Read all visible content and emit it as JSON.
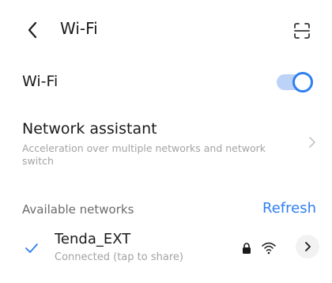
{
  "header": {
    "title": "Wi-Fi",
    "back_icon": "back-arrow-icon",
    "scan_icon": "scan-icon"
  },
  "wifi_toggle": {
    "label": "Wi-Fi",
    "enabled": true,
    "accent_color": "#2f7ff0"
  },
  "network_assistant": {
    "title": "Network assistant",
    "description": "Acceleration over multiple networks and network switch"
  },
  "available": {
    "label": "Available networks",
    "refresh_label": "Refresh"
  },
  "networks": [
    {
      "name": "Tenda_EXT",
      "status": "Connected (tap to share)",
      "connected": true,
      "secured": true,
      "signal_icon": "wifi-signal-icon"
    }
  ]
}
